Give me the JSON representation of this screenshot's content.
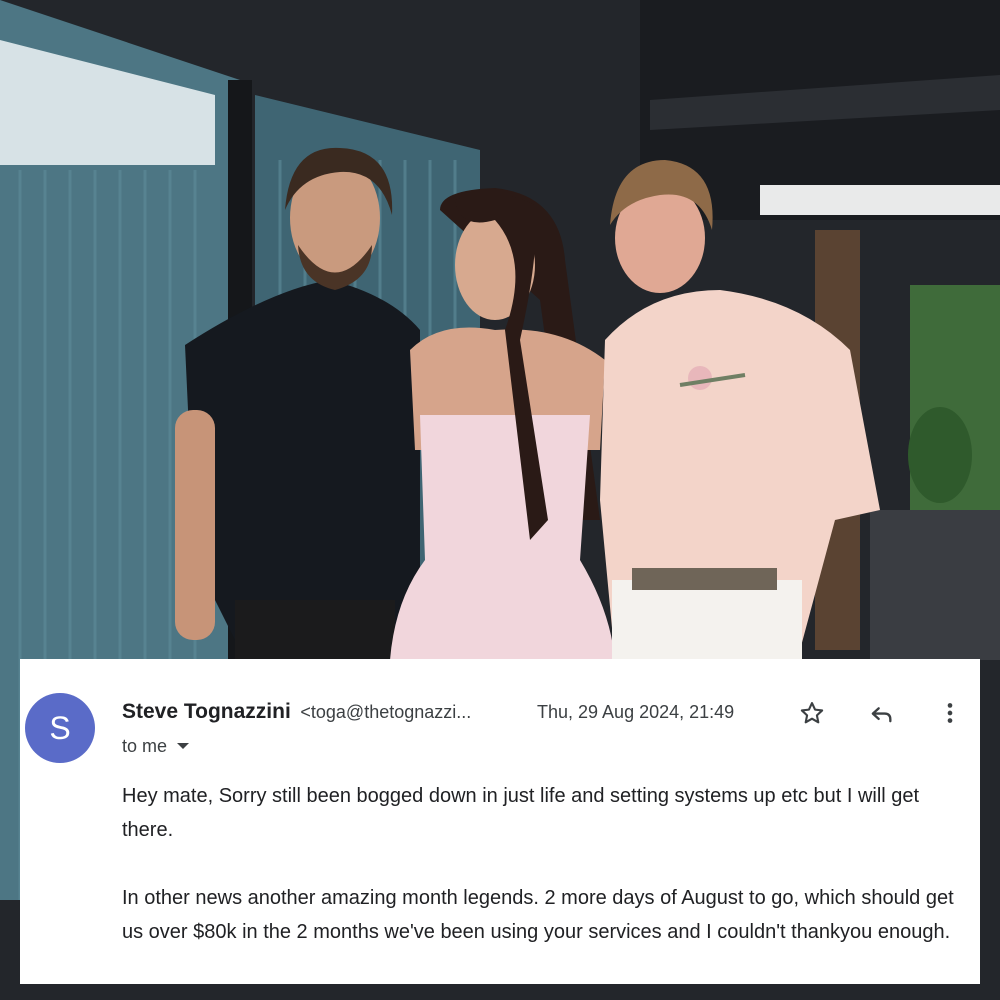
{
  "email": {
    "avatar_letter": "S",
    "sender_name": "Steve Tognazzini",
    "sender_email": "<toga@thetognazzi...",
    "timestamp": "Thu, 29 Aug 2024, 21:49",
    "recipients": "to me",
    "body_paragraphs": [
      "Hey mate, Sorry still been bogged down in just life and setting systems up etc but I will get there.",
      "In other news another amazing month legends. 2 more days of August to go, which should get us over $80k in the 2 months we've been using your services and I couldn't thankyou enough."
    ],
    "icons": {
      "star": "star-icon",
      "reply": "reply-icon",
      "more": "more-vert-icon"
    }
  },
  "colors": {
    "avatar": "#5a6bc8",
    "card_background": "#ffffff"
  }
}
